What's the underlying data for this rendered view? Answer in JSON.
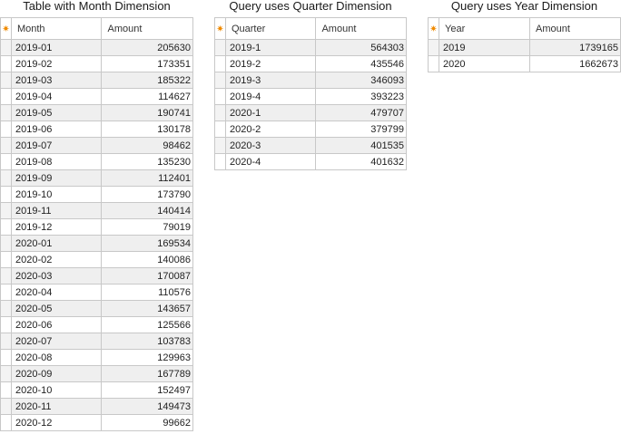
{
  "tables": [
    {
      "title": "Table with Month Dimension",
      "col1": "Month",
      "col2": "Amount",
      "rows": [
        [
          "2019-01",
          "205630"
        ],
        [
          "2019-02",
          "173351"
        ],
        [
          "2019-03",
          "185322"
        ],
        [
          "2019-04",
          "114627"
        ],
        [
          "2019-05",
          "190741"
        ],
        [
          "2019-06",
          "130178"
        ],
        [
          "2019-07",
          "98462"
        ],
        [
          "2019-08",
          "135230"
        ],
        [
          "2019-09",
          "112401"
        ],
        [
          "2019-10",
          "173790"
        ],
        [
          "2019-11",
          "140414"
        ],
        [
          "2019-12",
          "79019"
        ],
        [
          "2020-01",
          "169534"
        ],
        [
          "2020-02",
          "140086"
        ],
        [
          "2020-03",
          "170087"
        ],
        [
          "2020-04",
          "110576"
        ],
        [
          "2020-05",
          "143657"
        ],
        [
          "2020-06",
          "125566"
        ],
        [
          "2020-07",
          "103783"
        ],
        [
          "2020-08",
          "129963"
        ],
        [
          "2020-09",
          "167789"
        ],
        [
          "2020-10",
          "152497"
        ],
        [
          "2020-11",
          "149473"
        ],
        [
          "2020-12",
          "99662"
        ]
      ]
    },
    {
      "title": "Query uses Quarter Dimension",
      "col1": "Quarter",
      "col2": "Amount",
      "rows": [
        [
          "2019-1",
          "564303"
        ],
        [
          "2019-2",
          "435546"
        ],
        [
          "2019-3",
          "346093"
        ],
        [
          "2019-4",
          "393223"
        ],
        [
          "2020-1",
          "479707"
        ],
        [
          "2020-2",
          "379799"
        ],
        [
          "2020-3",
          "401535"
        ],
        [
          "2020-4",
          "401632"
        ]
      ]
    },
    {
      "title": "Query uses Year Dimension",
      "col1": "Year",
      "col2": "Amount",
      "rows": [
        [
          "2019",
          "1739165"
        ],
        [
          "2020",
          "1662673"
        ]
      ]
    }
  ],
  "icons": {
    "new_row": "asterisk-icon"
  },
  "colors": {
    "asterisk": "#f08a00",
    "grid_line": "#c8c8c8",
    "alt_row": "#efefef"
  }
}
